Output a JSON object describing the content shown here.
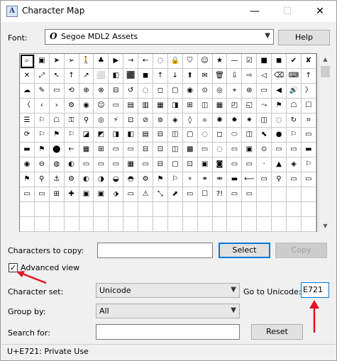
{
  "window": {
    "title": "Character Map",
    "title_icon": "app-icon",
    "minimize": "—",
    "maximize": "☐",
    "close": "✕"
  },
  "font_row": {
    "label": "Font:",
    "font_glyph": "O",
    "value": "Segoe MDL2 Assets",
    "help_label": "Help"
  },
  "grid": {
    "columns": 20,
    "rows": 12,
    "selected_index": 0,
    "cells": [
      "⌕",
      "▣",
      "➤",
      "➢",
      "🚶",
      "♣",
      "▶",
      "→",
      "←",
      "◌",
      "🔒",
      "⛉",
      "☺",
      "★",
      "—",
      "☑",
      "■",
      "◼",
      "✔",
      "✘",
      "✕",
      "⤢",
      "↖",
      "↑",
      "↗",
      "⬜",
      "◧",
      "⬛",
      "◼",
      "↑",
      "↓",
      "⬆",
      "✉",
      "🗑",
      "⇩",
      "⇨",
      "◁",
      "⌫",
      "⌨",
      "↑",
      "☁",
      "✎",
      "▭",
      "⟲",
      "⊕",
      "⊗",
      "⊟",
      "↺",
      "◌",
      "◻",
      "▢",
      "◉",
      "⊙",
      "◎",
      "⌖",
      "⊛",
      "▭",
      "◀",
      "🔊",
      "〉",
      "〈",
      "‹",
      "›",
      "⚙",
      "◉",
      "☺",
      "▭",
      "▤",
      "▥",
      "▦",
      "◨",
      "⊞",
      "◫",
      "▦",
      "◰",
      "◱",
      "⤳",
      "⚑",
      "☖",
      "☐",
      "☰",
      "⚐",
      "☖",
      "⚿",
      "⚲",
      "◎",
      "⚡",
      "⊡",
      "⊘",
      "⊚",
      "◈",
      "◊",
      "⟡",
      "✺",
      "✹",
      "✷",
      "◫",
      "◌",
      "↻",
      "⌗",
      "⟳",
      "⚐",
      "⚑",
      "⚐",
      "◪",
      "◩",
      "◨",
      "◧",
      "▤",
      "⊟",
      "◫",
      "▢",
      "◌",
      "◻",
      "⬭",
      "◫",
      "⬉",
      "●",
      "⚐",
      "▭",
      "▬",
      "⚑",
      "⬤",
      "←",
      "▦",
      "⊞",
      "▭",
      "▭",
      "⊟",
      "⊡",
      "◫",
      "▩",
      "▭",
      "◌",
      "▭",
      "▣",
      "⊙",
      "▭",
      "▭",
      "▬",
      "◉",
      "⊖",
      "◍",
      "◐",
      "▭",
      "▭",
      "▭",
      "▦",
      "▭",
      "⊟",
      "▢",
      "⊡",
      "▣",
      "◙",
      "▭",
      "▭",
      "·",
      "▲",
      "◈",
      "⚐",
      "⚑",
      "⚲",
      "⚓",
      "⚙",
      "◐",
      "◑",
      "◒",
      "◓",
      "⚙",
      "⚑",
      "⚐",
      "⚬",
      "⚭",
      "⚮",
      "▬",
      "⟵",
      "▭",
      "⚲",
      "▭",
      "▭",
      "▭",
      "▭",
      "⊞",
      "✚",
      "▣",
      "▣",
      "⬗",
      "▭",
      "⚠",
      "⤡",
      "⬈",
      "▭",
      "☐",
      "?!",
      "▭",
      "▭",
      "",
      "",
      "",
      "",
      "",
      "",
      "",
      "",
      "",
      "",
      "",
      "",
      "",
      "",
      "",
      "",
      "",
      "",
      "",
      "",
      "",
      "",
      "",
      "",
      "",
      "",
      "",
      "",
      "",
      "",
      "",
      "",
      "",
      "",
      "",
      "",
      "",
      "",
      "",
      ""
    ]
  },
  "copy_row": {
    "label": "Characters to copy:",
    "value": "",
    "select_label": "Select",
    "copy_label": "Copy"
  },
  "advanced": {
    "label": "Advanced view",
    "checked": "✓"
  },
  "charset_row": {
    "label": "Character set:",
    "value": "Unicode",
    "goto_label": "Go to Unicode:",
    "goto_value": "E721"
  },
  "group_row": {
    "label": "Group by:",
    "value": "All"
  },
  "search_row": {
    "label": "Search for:",
    "value": "",
    "reset_label": "Reset"
  },
  "status": {
    "text": "U+E721: Private Use"
  },
  "colors": {
    "accent": "#0078d7",
    "annotation": "#e81123"
  }
}
